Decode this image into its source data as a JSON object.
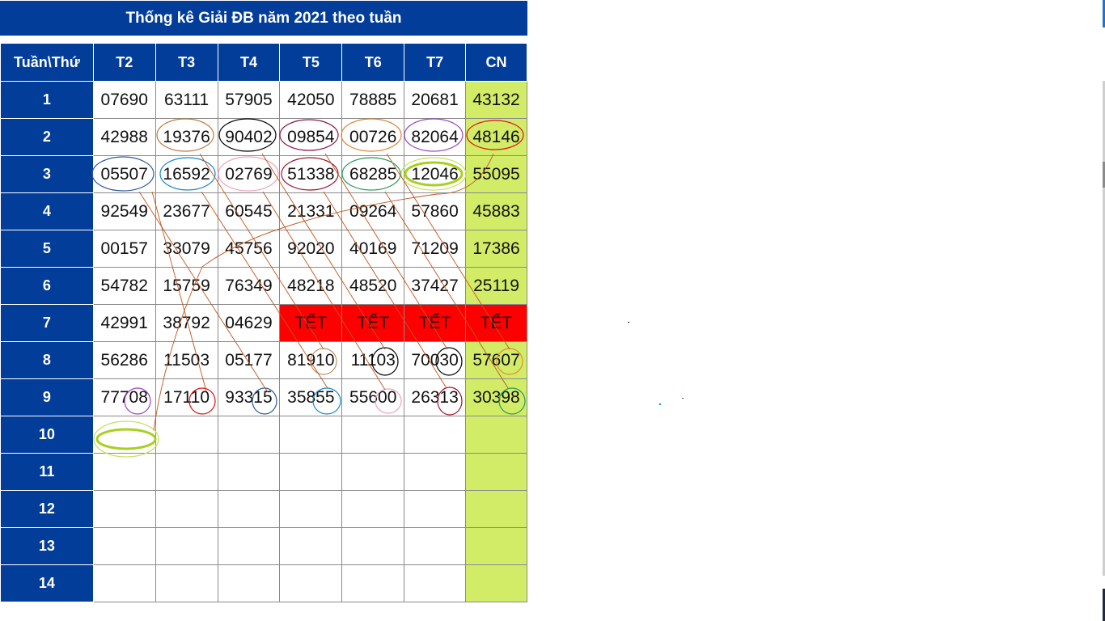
{
  "title": "Thống kê Giải ĐB năm 2021 theo tuần",
  "header": [
    "Tuần\\Thứ",
    "T2",
    "T3",
    "T4",
    "T5",
    "T6",
    "T7",
    "CN"
  ],
  "rows": [
    {
      "week": "1",
      "cells": [
        "07690",
        "63111",
        "57905",
        "42050",
        "78885",
        "20681",
        "43132"
      ]
    },
    {
      "week": "2",
      "cells": [
        "42988",
        "19376",
        "90402",
        "09854",
        "00726",
        "82064",
        "48146"
      ]
    },
    {
      "week": "3",
      "cells": [
        "05507",
        "16592",
        "02769",
        "51338",
        "68285",
        "12046",
        "55095"
      ]
    },
    {
      "week": "4",
      "cells": [
        "92549",
        "23677",
        "60545",
        "21331",
        "09264",
        "57860",
        "45883"
      ]
    },
    {
      "week": "5",
      "cells": [
        "00157",
        "33079",
        "45756",
        "92020",
        "40169",
        "71209",
        "17386"
      ]
    },
    {
      "week": "6",
      "cells": [
        "54782",
        "15759",
        "76349",
        "48218",
        "48520",
        "37427",
        "25119"
      ]
    },
    {
      "week": "7",
      "cells": [
        "42991",
        "38792",
        "04629",
        "TẾT",
        "TẾT",
        "TẾT",
        "TẾT"
      ]
    },
    {
      "week": "8",
      "cells": [
        "56286",
        "11503",
        "05177",
        "81910",
        "11103",
        "70030",
        "57607"
      ]
    },
    {
      "week": "9",
      "cells": [
        "77708",
        "17110",
        "93315",
        "35855",
        "55600",
        "26313",
        "30398"
      ]
    },
    {
      "week": "10",
      "cells": [
        "",
        "",
        "",
        "",
        "",
        "",
        ""
      ]
    },
    {
      "week": "11",
      "cells": [
        "",
        "",
        "",
        "",
        "",
        "",
        ""
      ]
    },
    {
      "week": "12",
      "cells": [
        "",
        "",
        "",
        "",
        "",
        "",
        ""
      ]
    },
    {
      "week": "13",
      "cells": [
        "",
        "",
        "",
        "",
        "",
        "",
        ""
      ]
    },
    {
      "week": "14",
      "cells": [
        "",
        "",
        "",
        "",
        "",
        "",
        ""
      ]
    }
  ],
  "colors": {
    "header_bg": "#033d9a",
    "sunday_bg": "#d2ec68",
    "tet_bg": "#ff0000"
  }
}
